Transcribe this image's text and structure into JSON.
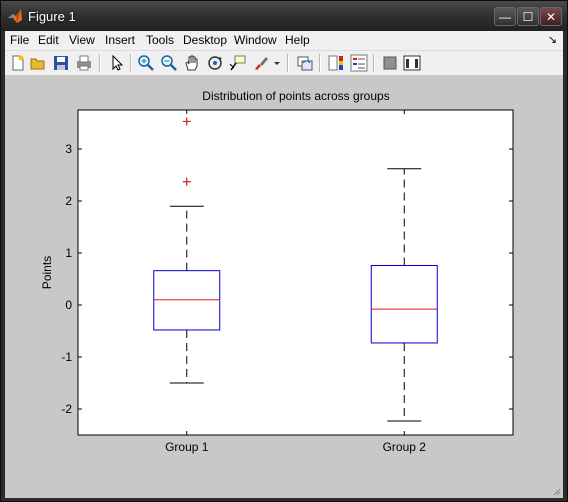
{
  "window": {
    "title": "Figure 1",
    "controls": {
      "minimize": "—",
      "maximize": "☐",
      "close": "✕"
    }
  },
  "menubar": {
    "items": [
      "File",
      "Edit",
      "View",
      "Insert",
      "Tools",
      "Desktop",
      "Window",
      "Help"
    ]
  },
  "toolbar": {
    "buttons": [
      "new-figure-icon",
      "open-file-icon",
      "save-icon",
      "print-icon",
      "pointer-icon",
      "zoom-in-icon",
      "zoom-out-icon",
      "pan-hand-icon",
      "rotate-3d-icon",
      "data-cursor-icon",
      "brush-icon",
      "brush-dropdown-icon",
      "link-plot-icon",
      "colorbar-icon",
      "legend-icon",
      "hide-plot-tools-icon",
      "show-plot-tools-icon"
    ]
  },
  "colors": {
    "box": "#0000c8",
    "median": "#e01818",
    "outlier": "#d02020",
    "whisker": "#000000",
    "figure_bg": "#c8c8c8",
    "axes_bg": "#ffffff"
  },
  "chart_data": {
    "type": "box",
    "title": "Distribution of points across groups",
    "xlabel": "",
    "ylabel": "Points",
    "categories": [
      "Group 1",
      "Group 2"
    ],
    "ylim": [
      -2.5,
      3.75
    ],
    "yticks": [
      -2,
      -1,
      0,
      1,
      2,
      3
    ],
    "grid": false,
    "boxes": [
      {
        "name": "Group 1",
        "lower_whisker": -1.5,
        "q1": -0.48,
        "median": 0.1,
        "q3": 0.66,
        "upper_whisker": 1.9,
        "outliers": [
          2.37,
          3.53
        ]
      },
      {
        "name": "Group 2",
        "lower_whisker": -2.23,
        "q1": -0.73,
        "median": -0.08,
        "q3": 0.76,
        "upper_whisker": 2.62,
        "outliers": []
      }
    ]
  }
}
